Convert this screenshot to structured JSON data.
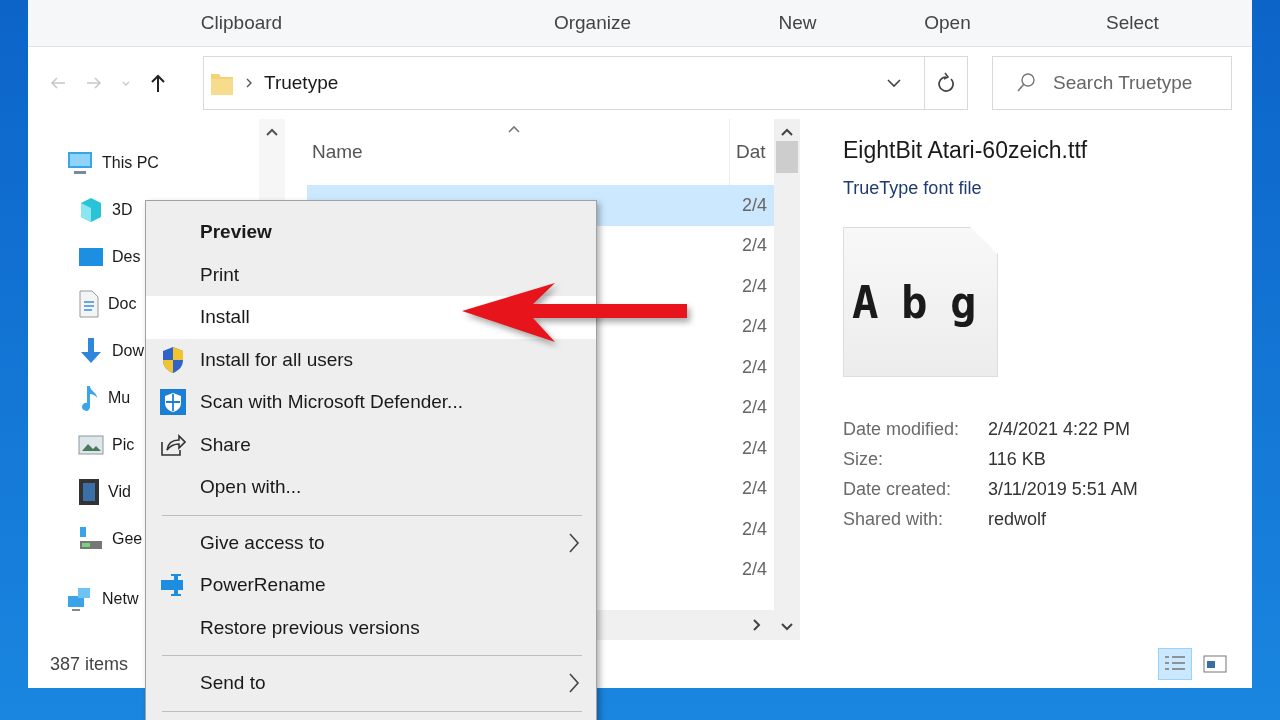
{
  "ribbon": {
    "groups": [
      "Clipboard",
      "Organize",
      "New",
      "Open",
      "Select"
    ]
  },
  "address_bar": {
    "nav_buttons": [
      {
        "kind": "back",
        "disabled": true
      },
      {
        "kind": "forward",
        "disabled": true
      },
      {
        "kind": "recent",
        "disabled": true
      },
      {
        "kind": "up",
        "disabled": false
      }
    ],
    "path": "Truetype",
    "search": {
      "placeholder": "Search Truetype"
    }
  },
  "navigation": {
    "items": [
      {
        "label": "This PC",
        "kind": "pc",
        "children": [
          {
            "label": "3D",
            "kind": "cube"
          },
          {
            "label": "Des",
            "kind": "desktop"
          },
          {
            "label": "Doc",
            "kind": "document"
          },
          {
            "label": "Dow",
            "kind": "download"
          },
          {
            "label": "Mu",
            "kind": "music"
          },
          {
            "label": "Pic",
            "kind": "pictures"
          },
          {
            "label": "Vid",
            "kind": "videos"
          },
          {
            "label": "Gee",
            "kind": "drive"
          }
        ]
      },
      {
        "label": "Netw",
        "kind": "network"
      }
    ]
  },
  "file_list": {
    "columns": [
      {
        "label": "Name",
        "sorted": true
      },
      {
        "label": "Dat"
      }
    ],
    "rows": [
      {
        "date": "2/4",
        "selected": true
      },
      {
        "date": "2/4",
        "selected": false
      },
      {
        "date": "2/4",
        "selected": false
      },
      {
        "date": "2/4",
        "selected": false
      },
      {
        "date": "2/4",
        "selected": false
      },
      {
        "date": "2/4",
        "selected": false
      },
      {
        "date": "2/4",
        "selected": false
      },
      {
        "date": "2/4",
        "selected": false
      },
      {
        "date": "2/4",
        "selected": false
      },
      {
        "date": "2/4",
        "selected": false
      }
    ]
  },
  "context_menu": {
    "items": [
      {
        "kind": "plain",
        "label": "Preview",
        "bold": true,
        "selected": false,
        "submenu": false
      },
      {
        "kind": "plain",
        "label": "Print",
        "bold": false,
        "selected": false,
        "submenu": false
      },
      {
        "kind": "plain",
        "label": "Install",
        "bold": false,
        "selected": true,
        "submenu": false
      },
      {
        "kind": "uac",
        "label": "Install for all users",
        "bold": false,
        "selected": false,
        "submenu": false
      },
      {
        "kind": "defender",
        "label": "Scan with Microsoft Defender...",
        "bold": false,
        "selected": false,
        "submenu": false
      },
      {
        "kind": "share",
        "label": "Share",
        "bold": false,
        "selected": false,
        "submenu": false
      },
      {
        "kind": "plain",
        "label": "Open with...",
        "bold": false,
        "selected": false,
        "submenu": false
      },
      {
        "kind": "separator"
      },
      {
        "kind": "plain",
        "label": "Give access to",
        "bold": false,
        "selected": false,
        "submenu": true
      },
      {
        "kind": "tool",
        "label": "PowerRename",
        "bold": false,
        "selected": false,
        "submenu": false
      },
      {
        "kind": "plain",
        "label": "Restore previous versions",
        "bold": false,
        "selected": false,
        "submenu": false
      },
      {
        "kind": "separator"
      },
      {
        "kind": "plain",
        "label": "Send to",
        "bold": false,
        "selected": false,
        "submenu": true
      },
      {
        "kind": "separator"
      }
    ]
  },
  "details": {
    "title": "EightBit Atari-60zeich.ttf",
    "type": "TrueType font file",
    "preview_text": "A b g",
    "properties": [
      {
        "label": "Date modified:",
        "value": "2/4/2021 4:22 PM"
      },
      {
        "label": "Size:",
        "value": "116 KB"
      },
      {
        "label": "Date created:",
        "value": "3/11/2019 5:51 AM"
      },
      {
        "label": "Shared with:",
        "value": "redwolf"
      }
    ]
  },
  "status_bar": {
    "count": "387 items",
    "views": [
      {
        "kind": "details",
        "selected": true
      },
      {
        "kind": "preview",
        "selected": false
      }
    ]
  },
  "annotation": {
    "kind": "arrow"
  }
}
